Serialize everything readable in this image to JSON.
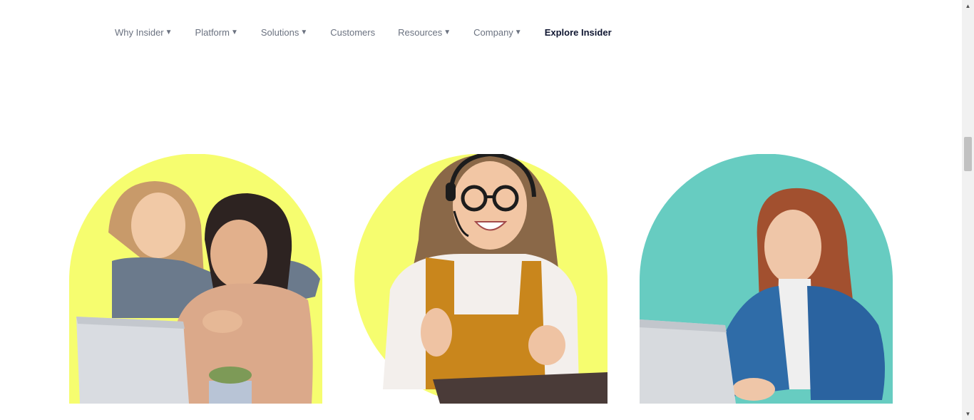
{
  "nav": {
    "items": [
      {
        "label": "Why Insider",
        "caret": "▼"
      },
      {
        "label": "Platform",
        "caret": "▼"
      },
      {
        "label": "Solutions",
        "caret": "▼"
      },
      {
        "label": "Customers",
        "caret": ""
      },
      {
        "label": "Resources",
        "caret": "▼"
      },
      {
        "label": "Company",
        "caret": "▼"
      },
      {
        "label": "Explore Insider",
        "caret": ""
      }
    ]
  },
  "colors": {
    "yellow": "#f6fd6f",
    "teal": "#67ccc1",
    "nav_text": "#6b7280",
    "nav_strong": "#0f1631"
  },
  "scrollbar": {
    "up": "▲",
    "down": "▼"
  }
}
